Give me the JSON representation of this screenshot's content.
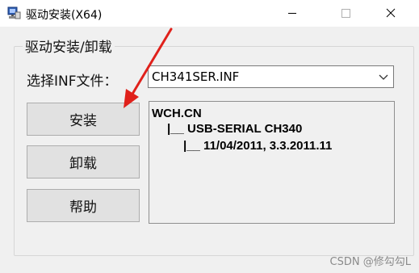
{
  "window": {
    "title": "驱动安装(X64)",
    "icon": "driver-setup-icon",
    "controls": [
      "minimize",
      "maximize",
      "close"
    ]
  },
  "group": {
    "title": "驱动安装/卸载"
  },
  "inf_selector": {
    "label": "选择INF文件：",
    "value": "CH341SER.INF"
  },
  "buttons": {
    "install": "安装",
    "uninstall": "卸载",
    "help": "帮助"
  },
  "info": {
    "line1": "WCH.CN",
    "line2": "|__ USB-SERIAL CH340",
    "line3": "|__ 11/04/2011, 3.3.2011.11"
  },
  "annotation": {
    "arrow_color": "#e0211b",
    "points_to": "install-button"
  },
  "watermark": "CSDN @修勾勾L"
}
